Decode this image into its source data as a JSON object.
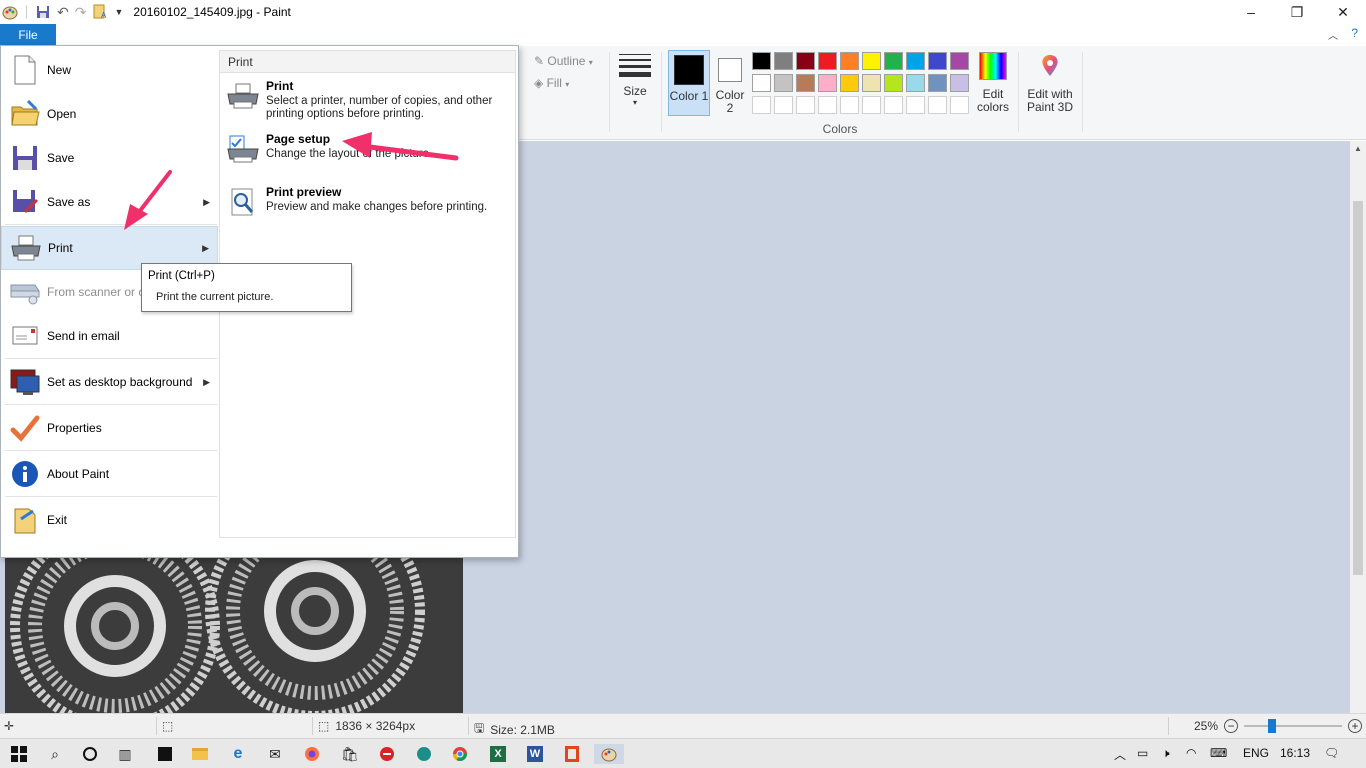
{
  "window": {
    "title": "20160102_145409.jpg - Paint",
    "controls": {
      "minimize": "–",
      "restore": "❐",
      "close": "✕"
    }
  },
  "ribbon": {
    "file_tab": "File",
    "outline_label": "Outline",
    "fill_label": "Fill",
    "size_label": "Size",
    "color1_label": "Color 1",
    "color2_label": "Color 2",
    "edit_colors_label": "Edit colors",
    "edit_paint3d_label": "Edit with Paint 3D",
    "colors_group_label": "Colors",
    "color1_value": "#000000",
    "color2_value": "#ffffff",
    "palette_row1": [
      "#000000",
      "#7f7f7f",
      "#880015",
      "#ed1c24",
      "#ff7f27",
      "#fff200",
      "#22b14c",
      "#00a2e8",
      "#3f48cc",
      "#a349a4"
    ],
    "palette_row2": [
      "#ffffff",
      "#c3c3c3",
      "#b97a57",
      "#ffaec9",
      "#ffc90e",
      "#efe4b0",
      "#b5e61d",
      "#99d9ea",
      "#7092be",
      "#c8bfe7"
    ]
  },
  "file_menu": {
    "items": [
      {
        "label": "New",
        "icon": "new-file-icon"
      },
      {
        "label": "Open",
        "icon": "open-folder-icon"
      },
      {
        "label": "Save",
        "icon": "save-icon"
      },
      {
        "label": "Save as",
        "icon": "save-as-icon"
      },
      {
        "label": "Print",
        "icon": "printer-icon"
      },
      {
        "label": "From scanner or camera",
        "icon": "scanner-icon"
      },
      {
        "label": "Send in email",
        "icon": "email-icon"
      },
      {
        "label": "Set as desktop background",
        "icon": "desktop-background-icon"
      },
      {
        "label": "Properties",
        "icon": "checkmark-icon"
      },
      {
        "label": "About Paint",
        "icon": "info-icon"
      },
      {
        "label": "Exit",
        "icon": "exit-icon"
      }
    ],
    "from_scanner_visible": "From scanner or ca",
    "submenu": {
      "header": "Print",
      "items": [
        {
          "title": "Print",
          "desc": "Select a printer, number of copies, and other printing options before printing."
        },
        {
          "title": "Page setup",
          "desc": "Change the layout of the picture."
        },
        {
          "title": "Print preview",
          "desc": "Preview and make changes before printing."
        }
      ]
    }
  },
  "tooltip": {
    "title": "Print (Ctrl+P)",
    "desc": "Print the current picture."
  },
  "statusbar": {
    "dimensions": "1836 × 3264px",
    "size": "Size: 2.1MB",
    "zoom": "25%",
    "zoom_level": 0.25
  },
  "taskbar": {
    "language": "ENG",
    "time": "16:13"
  },
  "accent_color": "#1979ca",
  "annotation_color": "#f0306a"
}
